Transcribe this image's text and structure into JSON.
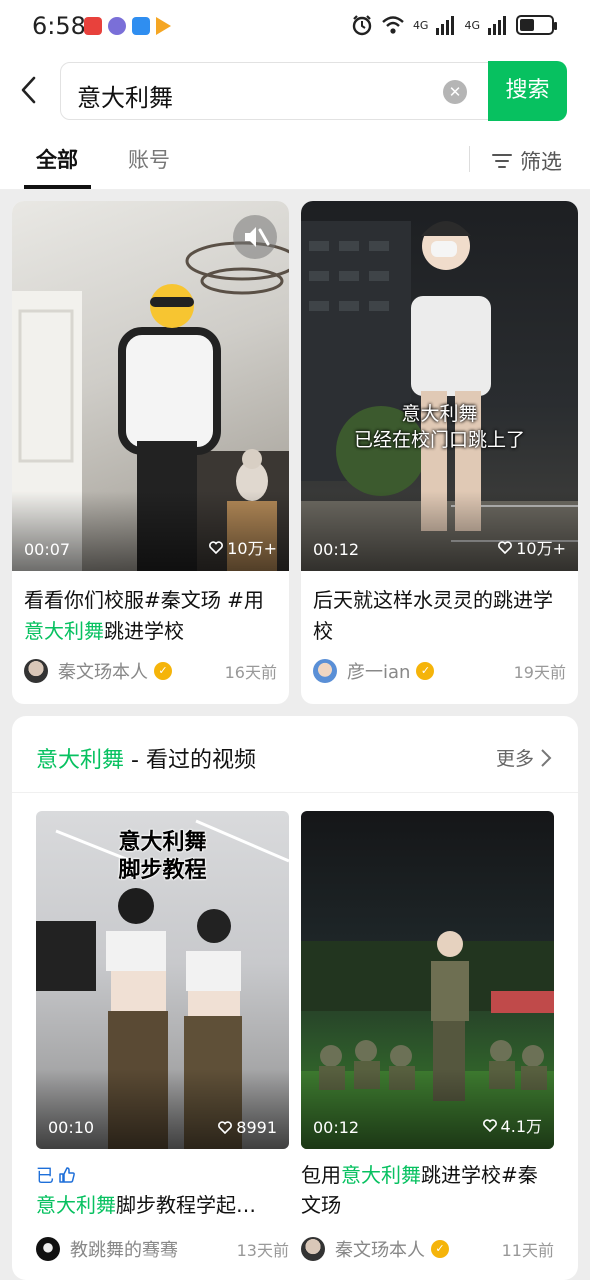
{
  "status_bar": {
    "time": "6:58",
    "network_1": "4G",
    "network_2": "4G",
    "battery_level": 0.45
  },
  "search": {
    "query": "意大利舞",
    "button_label": "搜索"
  },
  "tabs": {
    "all": "全部",
    "account": "账号",
    "filter": "筛选"
  },
  "results": [
    {
      "duration": "00:07",
      "likes": "10万+",
      "title_before": "看看你们校服#秦文玚 #用",
      "title_highlight": "意大利舞",
      "title_after": "跳进学校",
      "author": "秦文玚本人",
      "time": "16天前"
    },
    {
      "duration": "00:12",
      "likes": "10万+",
      "overlay_line1": "意大利舞",
      "overlay_line2": "已经在校门口跳上了",
      "title_before": "后天就这样水灵灵的跳进学校",
      "title_highlight": "",
      "title_after": "",
      "author": "彦一ian",
      "time": "19天前"
    }
  ],
  "history_section": {
    "keyword": "意大利舞",
    "title_suffix": " - 看过的视频",
    "more_label": "更多",
    "liked_label": "已",
    "videos": [
      {
        "duration": "00:10",
        "likes": "8991",
        "overlay_line1": "意大利舞",
        "overlay_line2": "脚步教程",
        "title_highlight": "意大利舞",
        "title_after": "脚步教程学起…",
        "author": "教跳舞的骞骞",
        "time": "13天前"
      },
      {
        "duration": "00:12",
        "likes": "4.1万",
        "title_before": "包用",
        "title_highlight": "意大利舞",
        "title_after": "跳进学校#秦文玚",
        "author": "秦文玚本人",
        "time": "11天前"
      }
    ]
  },
  "colors": {
    "accent_green": "#07c160",
    "verified_gold": "#f5b40a",
    "liked_blue": "#1e6fd9"
  }
}
